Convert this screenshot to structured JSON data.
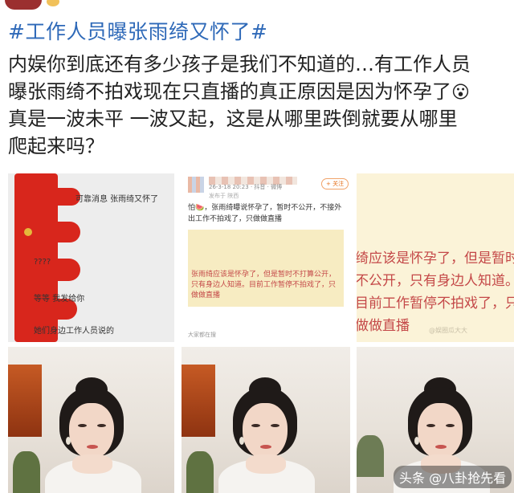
{
  "post": {
    "hashtag": "#工作人员曝张雨绮又怀了#",
    "body_line1": "内娱你到底还有多少孩子是我们不知道的…有工作人员",
    "body_line2": "曝张雨绮不拍戏现在只直播的真正原因是因为怀孕了",
    "body_emoji": "😮",
    "body_line3": "真是一波未平 一波又起，这是从哪里跌倒就要从哪里",
    "body_line4": "爬起来吗？"
  },
  "screenshot1": {
    "msg1": "可靠消息 张雨绮又怀了",
    "msg2": "????",
    "msg3": "等等 我发给你",
    "msg4": "她们身边工作人员说的"
  },
  "screenshot2": {
    "meta": "26-3-18 20:23 · 抖音 · 微博",
    "meta2": "发布于 陕西",
    "follow": "+ 关注",
    "body": "怕🍉，张雨绮曝说怀孕了，暂时不公开，不接外出工作不拍戏了，只做做直播",
    "card": "张雨绮应该是怀孕了，但是暂时不打算公开，只有身边人知道。目前工作暂停不拍戏了，只做做直播",
    "footer": "大家都在搜"
  },
  "screenshot3": {
    "zoom_text": "绮应该是怀孕了，但是暂时不公开，只有身边人知道。目前工作暂停不拍戏了，只做做直播",
    "watermark": "@娱圈瓜大大"
  },
  "footer": {
    "source": "头条 @八卦抢先看"
  },
  "colors": {
    "hashtag": "#2e69b8",
    "redaction": "#d8261c",
    "card_text": "#c44848"
  }
}
